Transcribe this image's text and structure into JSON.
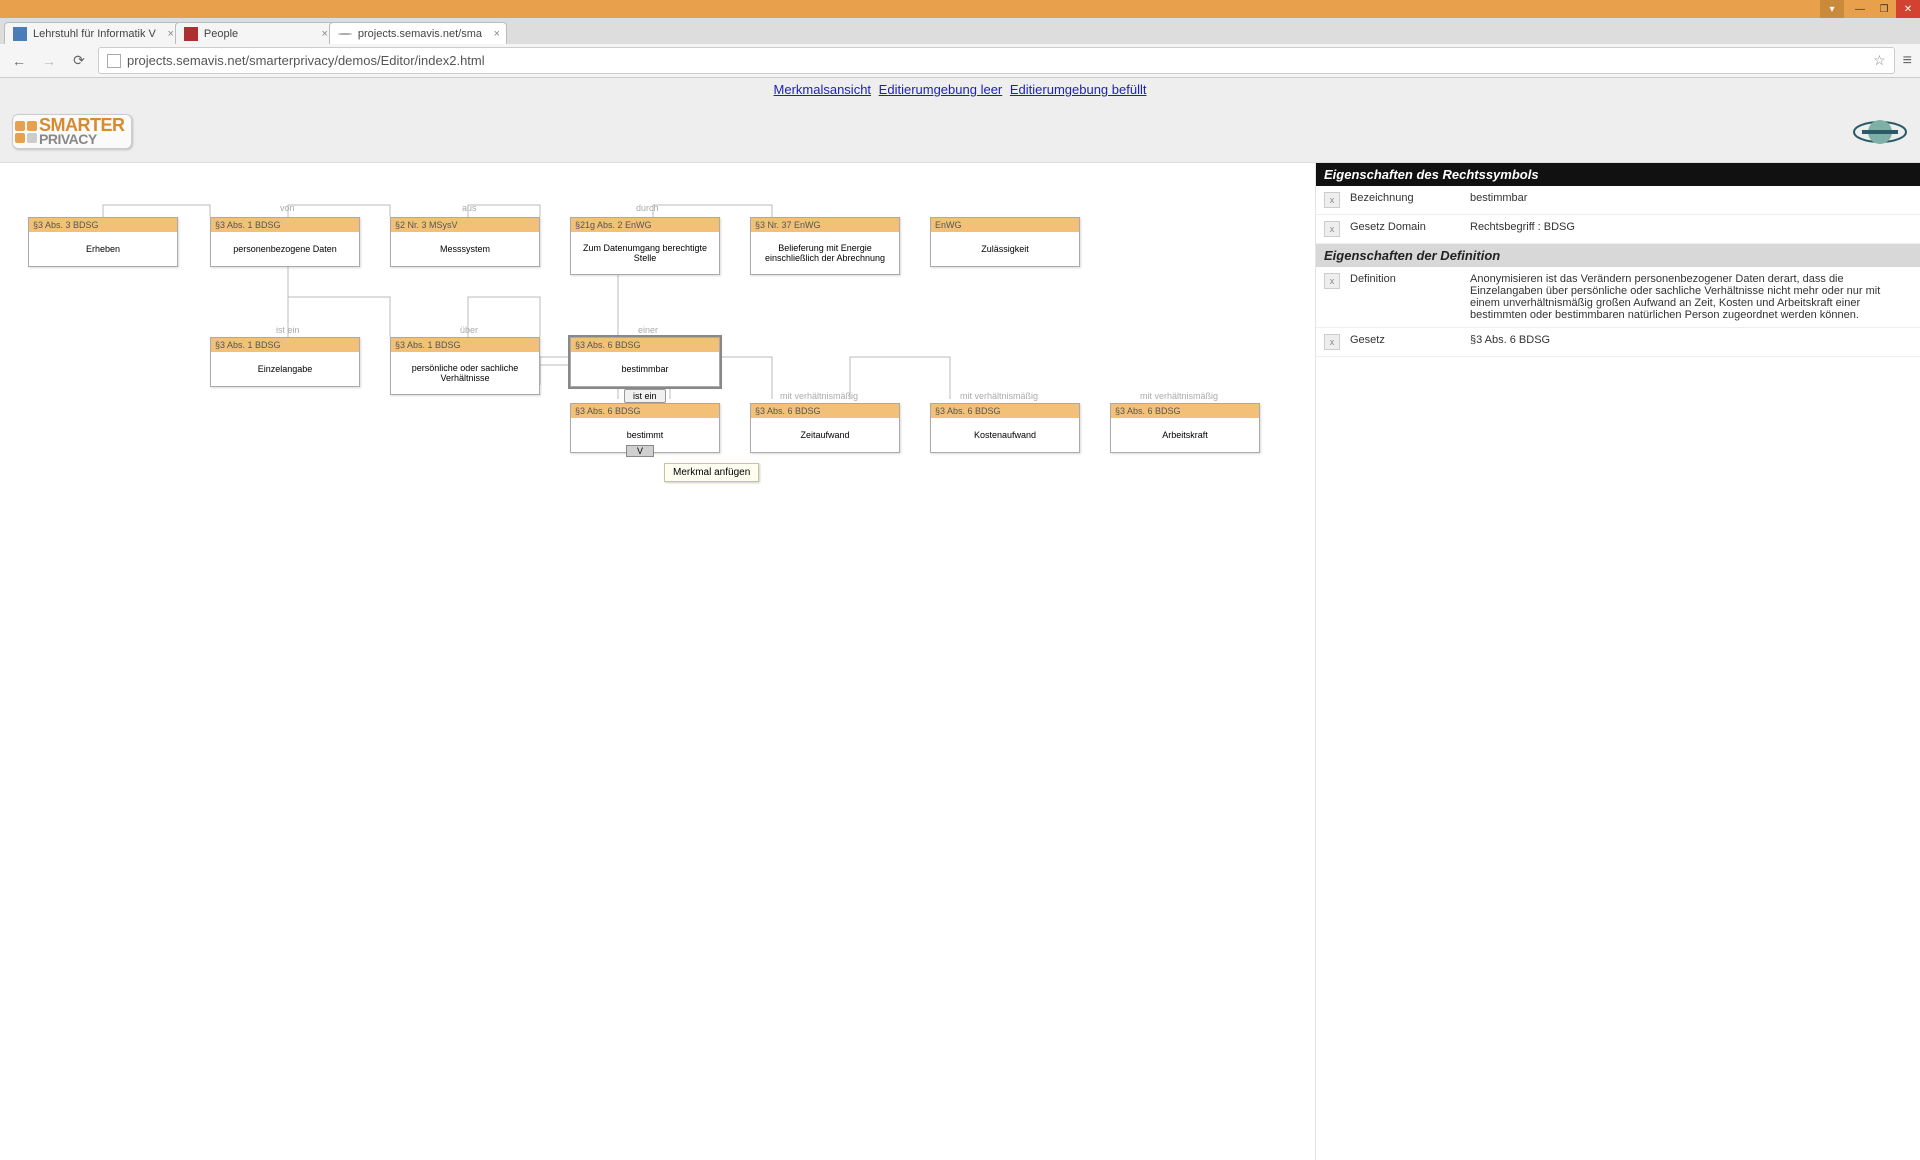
{
  "browser": {
    "tabs": [
      {
        "title": "Lehrstuhl für Informatik V",
        "favicon": "doc"
      },
      {
        "title": "People",
        "favicon": "pdf"
      },
      {
        "title": "projects.semavis.net/sma",
        "favicon": "page",
        "active": true
      }
    ],
    "url": "projects.semavis.net/smarterprivacy/demos/Editor/index2.html"
  },
  "links": {
    "l1": "Merkmalsansicht",
    "l2": "Editierumgebung leer",
    "l3": "Editierumgebung befüllt"
  },
  "logo": {
    "line1": "SMARTER",
    "line2": "PRIVACY"
  },
  "edges": {
    "von": "von",
    "aus": "aus",
    "durch": "durch",
    "ist_ein": "ist ein",
    "uber": "über",
    "einer": "einer",
    "mit": "mit verhältnismäßig",
    "pill_ist_ein": "ist ein"
  },
  "tooltip": "Merkmal anfügen",
  "v_handle": "V",
  "nodes": {
    "r1c1": {
      "head": "§3 Abs. 3 BDSG",
      "body": "Erheben"
    },
    "r1c2": {
      "head": "§3 Abs. 1 BDSG",
      "body": "personenbezogene Daten"
    },
    "r1c3": {
      "head": "§2 Nr. 3 MSysV",
      "body": "Messsystem"
    },
    "r1c4": {
      "head": "§21g Abs. 2 EnWG",
      "body": "Zum Datenumgang berechtigte Stelle"
    },
    "r1c5": {
      "head": "§3 Nr. 37 EnWG",
      "body": "Belieferung mit Energie einschließlich der Abrechnung"
    },
    "r1c6": {
      "head": "EnWG",
      "body": "Zulässigkeit"
    },
    "r2c2": {
      "head": "§3 Abs. 1 BDSG",
      "body": "Einzelangabe"
    },
    "r2c3": {
      "head": "§3 Abs. 1 BDSG",
      "body": "persönliche oder sachliche Verhältnisse"
    },
    "r2c4": {
      "head": "§3 Abs. 6 BDSG",
      "body": "bestimmbar"
    },
    "r3c4": {
      "head": "§3 Abs. 6 BDSG",
      "body": "bestimmt"
    },
    "r3c5": {
      "head": "§3 Abs. 6 BDSG",
      "body": "Zeitaufwand"
    },
    "r3c6": {
      "head": "§3 Abs. 6 BDSG",
      "body": "Kostenaufwand"
    },
    "r3c7": {
      "head": "§3 Abs. 6 BDSG",
      "body": "Arbeitskraft"
    }
  },
  "panel": {
    "header1": "Eigenschaften des Rechtssymbols",
    "header2": "Eigenschaften der Definition",
    "rows1": [
      {
        "key": "Bezeichnung",
        "val": "bestimmbar"
      },
      {
        "key": "Gesetz Domain",
        "val": "Rechtsbegriff : BDSG"
      }
    ],
    "rows2": [
      {
        "key": "Definition",
        "val": "Anonymisieren ist das Verändern personenbezogener Daten derart, dass die Einzelangaben über persönliche oder sachliche Verhältnisse nicht mehr oder nur mit einem unverhältnismäßig großen Aufwand an Zeit, Kosten und Arbeitskraft einer bestimmten oder bestimmbaren natürlichen Person zugeordnet werden können."
      },
      {
        "key": "Gesetz",
        "val": "§3 Abs. 6 BDSG"
      }
    ],
    "del": "x"
  }
}
